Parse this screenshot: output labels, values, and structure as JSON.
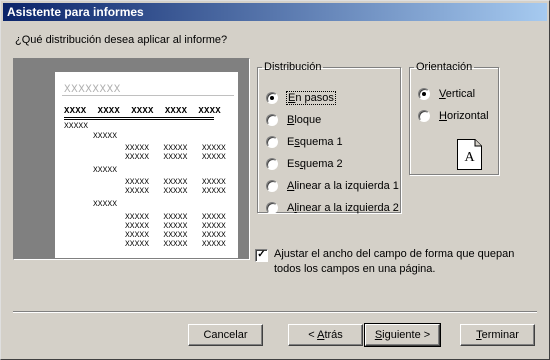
{
  "window": {
    "title": "Asistente para informes"
  },
  "question": "¿Qué distribución desea aplicar al informe?",
  "preview": {
    "title_placeholder": "XXXXXXXX",
    "header_row": "XXXX  XXXX  XXXX  XXXX  XXXX",
    "level1": "XXXXX",
    "level2": "XXXXX",
    "detail": "XXXXX   XXXXX   XXXXX"
  },
  "distribution": {
    "legend": "Distribución",
    "options": [
      {
        "label": "En pasos",
        "accel": "E",
        "selected": true
      },
      {
        "label": "Bloque",
        "accel": "B",
        "selected": false
      },
      {
        "label": "Esquema 1",
        "accel": "s",
        "selected": false
      },
      {
        "label": "Esquema 2",
        "accel": "q",
        "selected": false
      },
      {
        "label": "Alinear a la izquierda 1",
        "accel": "A",
        "selected": false
      },
      {
        "label": "Alinear a la izquierda 2",
        "accel": "l",
        "selected": false
      }
    ]
  },
  "orientation": {
    "legend": "Orientación",
    "options": [
      {
        "label": "Vertical",
        "accel": "V",
        "selected": true
      },
      {
        "label": "Horizontal",
        "accel": "H",
        "selected": false
      }
    ],
    "icon_letter": "A"
  },
  "adjust_checkbox": {
    "checked": true,
    "label": "Ajustar el ancho del campo de forma que quepan todos los campos en una página."
  },
  "buttons": {
    "cancel": "Cancelar",
    "back": "< Atrás",
    "next": "Siguiente >",
    "finish": "Terminar"
  }
}
